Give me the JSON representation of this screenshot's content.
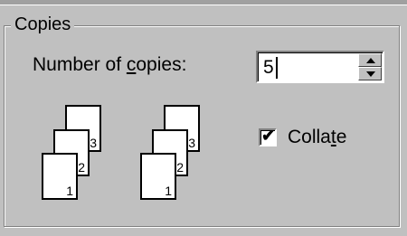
{
  "group": {
    "title": "Copies"
  },
  "copies": {
    "label_before": "Number of ",
    "label_accel": "c",
    "label_after": "opies:",
    "value": "5"
  },
  "collate": {
    "checked": true,
    "label_before": "Colla",
    "label_accel": "t",
    "label_after": "e"
  },
  "illustration": {
    "pages": [
      "1",
      "2",
      "3"
    ]
  }
}
